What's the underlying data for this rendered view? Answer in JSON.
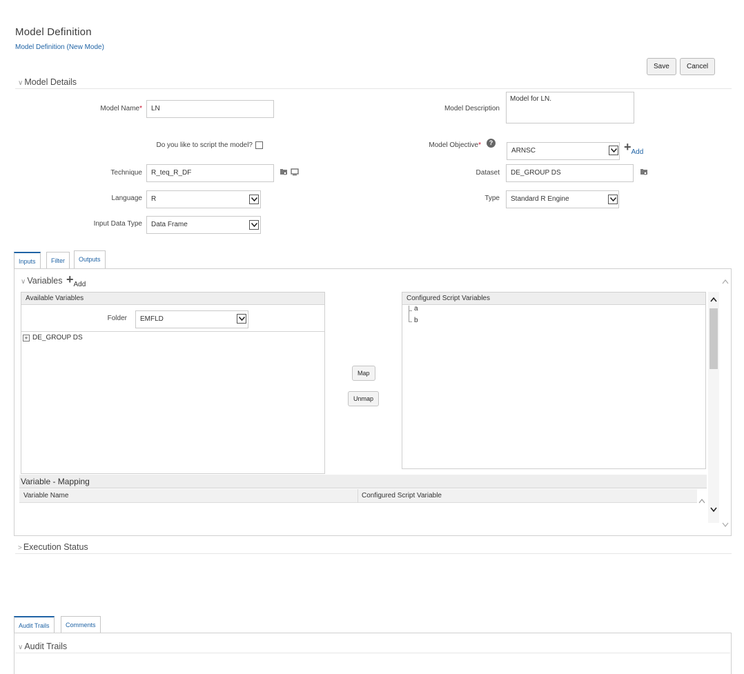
{
  "page": {
    "title": "Model Definition",
    "subtitle": "Model Definition (New Mode)"
  },
  "toolbar": {
    "save_label": "Save",
    "cancel_label": "Cancel"
  },
  "model_details": {
    "header": "Model Details",
    "model_name_label": "Model Name",
    "required_marker": "*",
    "model_name_value": "LN",
    "model_description_label": "Model Description",
    "model_description_value": "Model for LN.",
    "script_label": "Do you like to script the model?",
    "model_objective_label": "Model Objective",
    "model_objective_value": "ARNSC",
    "add_label": "Add",
    "technique_label": "Technique",
    "technique_value": "R_teq_R_DF",
    "dataset_label": "Dataset",
    "dataset_value": "DE_GROUP DS",
    "language_label": "Language",
    "language_value": "R",
    "type_label": "Type",
    "type_value": "Standard R Engine",
    "input_data_type_label": "Input Data Type",
    "input_data_type_value": "Data Frame"
  },
  "tabs": [
    {
      "label": "Inputs",
      "active": true
    },
    {
      "label": "Filter",
      "active": false
    },
    {
      "label": "Outputs",
      "active": false
    }
  ],
  "variables": {
    "header": "Variables",
    "add_label": "Add",
    "available_header": "Available Variables",
    "folder_label": "Folder",
    "folder_value": "EMFLD",
    "tree_root": "DE_GROUP DS",
    "map_label": "Map",
    "unmap_label": "Unmap",
    "configured_header": "Configured Script Variables",
    "configured_items": [
      "a",
      "b"
    ],
    "mapping_header": "Variable - Mapping",
    "mapping_columns": [
      "Variable Name",
      "Configured Script Variable"
    ]
  },
  "execution_status": {
    "header": "Execution Status"
  },
  "bottom_tabs": [
    {
      "label": "Audit Trails",
      "active": true
    },
    {
      "label": "Comments",
      "active": false
    }
  ],
  "audit_trails": {
    "header": "Audit Trails"
  },
  "icons": {
    "collapse": "chevron-down-icon",
    "expand": "chevron-right-icon",
    "dropdown": "dropdown-arrow-icon",
    "browse": "folder-browse-icon",
    "preview": "monitor-icon",
    "help": "help-icon",
    "add": "plus-icon",
    "tree_expand": "tree-expand-icon"
  },
  "colors": {
    "link": "#1f63a5",
    "required": "#c8102e"
  }
}
